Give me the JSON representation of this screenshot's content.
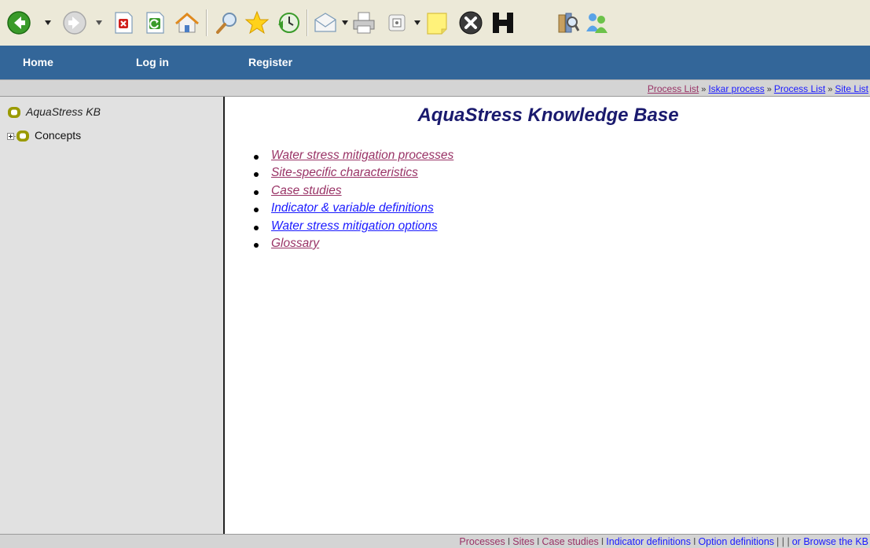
{
  "toolbar": {
    "icons": [
      "back-icon",
      "forward-icon",
      "stop-icon",
      "refresh-icon",
      "home-icon",
      "search-icon",
      "favorites-icon",
      "history-icon",
      "mail-icon",
      "print-icon",
      "media-icon",
      "notes-icon",
      "close-icon",
      "h-icon",
      "research-icon",
      "messenger-icon"
    ]
  },
  "nav": {
    "home": "Home",
    "login": "Log in",
    "register": "Register"
  },
  "breadcrumb": {
    "items": [
      "Process List",
      "Iskar process",
      "Process List",
      "Site List"
    ],
    "separator": "»"
  },
  "tree": {
    "root": "AquaStress KB",
    "child": "Concepts"
  },
  "main": {
    "title": "AquaStress Knowledge Base",
    "links": [
      {
        "label": "Water stress mitigation processes",
        "visited": true
      },
      {
        "label": "Site-specific characteristics",
        "visited": true
      },
      {
        "label": "Case studies",
        "visited": true
      },
      {
        "label": "Indicator & variable definitions",
        "visited": false
      },
      {
        "label": "Water stress mitigation options",
        "visited": false
      },
      {
        "label": "Glossary",
        "visited": true
      }
    ]
  },
  "footer": {
    "processes": "Processes",
    "sites": "Sites",
    "case_studies": "Case studies",
    "indicator_definitions": "Indicator definitions",
    "option_definitions": "Option definitions",
    "triple_pipe": "| | |",
    "browse": "or Browse the KB",
    "separator": "I"
  },
  "colors": {
    "nav_bg": "#336699",
    "visited_link": "#993366",
    "unvisited_link": "#1a1aff",
    "title": "#1a1a6e",
    "sidebar_bg": "#e1e1e1",
    "node_icon": "#9a9a00"
  }
}
